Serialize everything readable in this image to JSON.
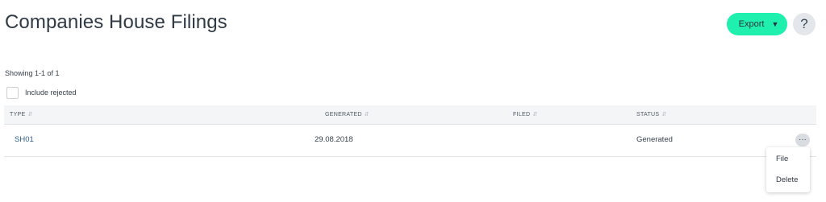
{
  "header": {
    "title": "Companies House Filings",
    "export_label": "Export",
    "export_caret_icon": "caret-down-icon",
    "help_label": "?",
    "accent_color": "#1ff0ad"
  },
  "summary": {
    "showing": "Showing 1-1 of 1",
    "include_rejected_label": "Include rejected",
    "include_rejected_checked": false
  },
  "table": {
    "columns": [
      "TYPE",
      "GENERATED",
      "FILED",
      "STATUS"
    ],
    "sort_icon": "sort-arrows-icon",
    "rows": [
      {
        "type": "SH01",
        "generated": "29.08.2018",
        "filed": "",
        "status": "Generated"
      }
    ]
  },
  "row_menu": {
    "trigger_icon": "more-dots-icon",
    "trigger_label": "···",
    "items": [
      "File",
      "Delete"
    ]
  }
}
